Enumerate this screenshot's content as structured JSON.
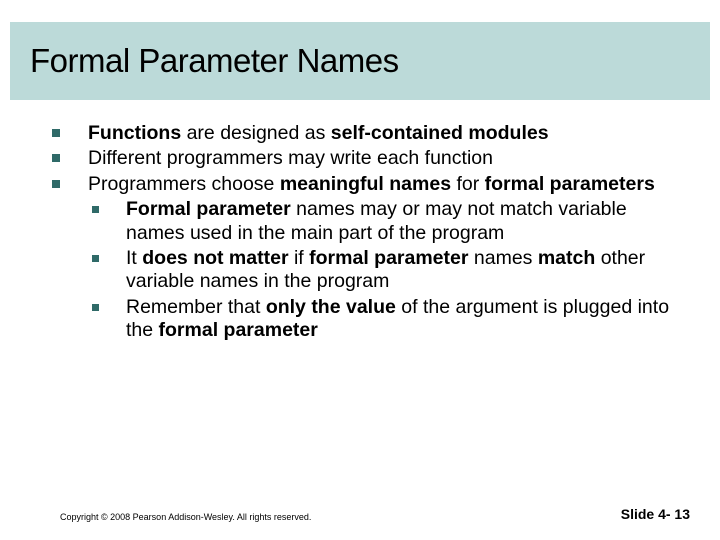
{
  "title": "Formal Parameter Names",
  "bullets": {
    "b1_pre": "Functions",
    "b1_mid": " are designed as ",
    "b1_bold2": "self-contained modules",
    "b2": "Different programmers may write each function",
    "b3_pre": "Programmers choose ",
    "b3_bold": "meaningful names",
    "b3_mid": " for ",
    "b3_bold2": "formal parameters",
    "s1_bold": "Formal parameter",
    "s1_rest": " names may or may not match variable names used in the main part of the program",
    "s2_pre": "It ",
    "s2_bold1": "does not matter",
    "s2_mid1": " if ",
    "s2_bold2": "formal parameter",
    "s2_mid2": " names ",
    "s2_bold3": "match",
    "s2_rest": " other variable names in the program",
    "s3_pre": "Remember that ",
    "s3_bold1": "only the value",
    "s3_mid": " of the argument is plugged into the ",
    "s3_bold2": "formal parameter"
  },
  "footer": {
    "copyright": "Copyright © 2008 Pearson Addison-Wesley. All rights reserved.",
    "slidenum": "Slide 4- 13"
  }
}
